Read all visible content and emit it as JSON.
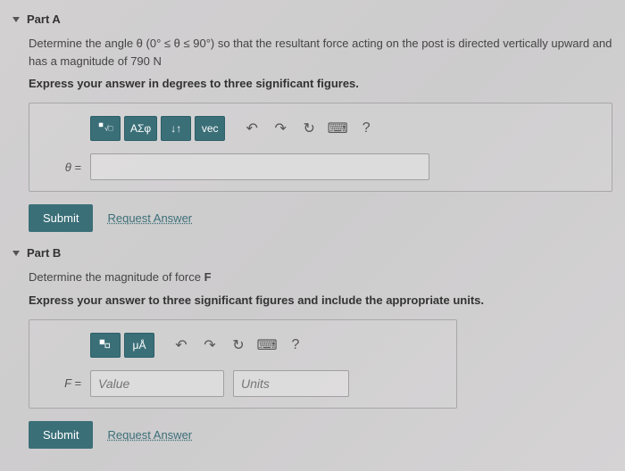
{
  "partA": {
    "title": "Part A",
    "problem_html": "Determine the angle θ (0° ≤ θ ≤ 90°) so that the resultant force acting on the post is directed vertically upward and has a magnitude of 790 N",
    "instruction": "Express your answer in degrees to three significant figures.",
    "toolbar": {
      "btn1": "template-icon",
      "btn2": "ΑΣφ",
      "btn3": "↓↑",
      "btn4": "vec",
      "undo": "↶",
      "redo": "↷",
      "reset": "↻",
      "keyboard": "⌨",
      "help": "?"
    },
    "label": "θ =",
    "input_value": "",
    "submit": "Submit",
    "request": "Request Answer"
  },
  "partB": {
    "title": "Part B",
    "problem": "Determine the magnitude of force F",
    "instruction": "Express your answer to three significant figures and include the appropriate units.",
    "toolbar": {
      "btn1": "template-icon",
      "btn2": "μÅ",
      "undo": "↶",
      "redo": "↷",
      "reset": "↻",
      "keyboard": "⌨",
      "help": "?"
    },
    "label": "F =",
    "value_placeholder": "Value",
    "units_placeholder": "Units",
    "submit": "Submit",
    "request": "Request Answer"
  }
}
